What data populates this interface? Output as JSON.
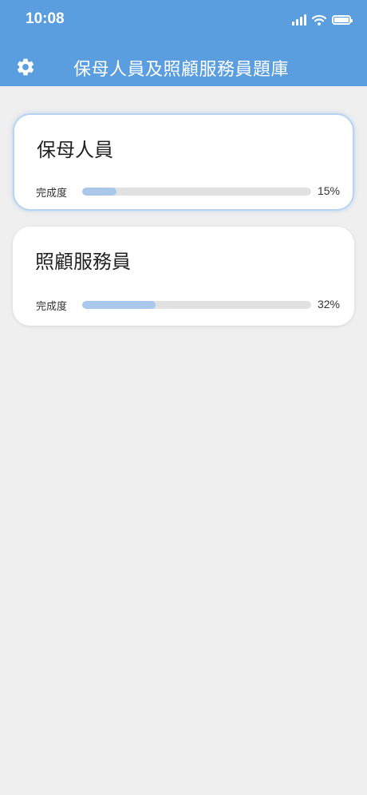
{
  "status_bar": {
    "time": "10:08",
    "icons": [
      "signal-icon",
      "wifi-icon",
      "battery-icon"
    ]
  },
  "header": {
    "title": "保母人員及照顧服務員題庫",
    "settings_icon": "gear-icon",
    "background_color": "#5b9ee0"
  },
  "cards": [
    {
      "title": "保母人員",
      "progress_label": "完成度",
      "progress_percent": "15%",
      "progress_value": 0.15,
      "selected": true
    },
    {
      "title": "照顧服務員",
      "progress_label": "完成度",
      "progress_percent": "32%",
      "progress_value": 0.32,
      "selected": false
    }
  ],
  "colors": {
    "accent": "#5b9ee0",
    "progress_fill": "#a9c8ec",
    "progress_track": "#e1e1e1",
    "background": "#efefef"
  }
}
